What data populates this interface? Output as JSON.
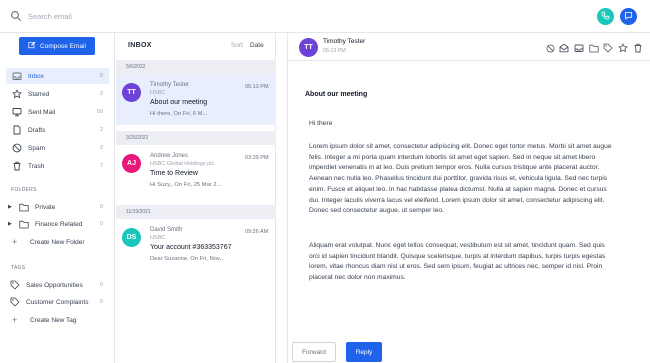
{
  "search": {
    "placeholder": "Search email"
  },
  "colors": {
    "accent": "#1e63e9",
    "phone": "#19c6b9"
  },
  "sidebar": {
    "compose_label": "Compose Email",
    "nav": [
      {
        "label": "Inbox",
        "count": "0",
        "icon": "inbox-icon"
      },
      {
        "label": "Starred",
        "count": "2",
        "icon": "star-icon"
      },
      {
        "label": "Sent Mail",
        "count": "50",
        "icon": "monitor-icon"
      },
      {
        "label": "Drafts",
        "count": "2",
        "icon": "document-icon"
      },
      {
        "label": "Spam",
        "count": "2",
        "icon": "ban-icon"
      },
      {
        "label": "Trash",
        "count": "7",
        "icon": "trash-icon"
      }
    ],
    "folders_label": "FOLDERS",
    "folders": [
      {
        "label": "Private",
        "count": "0"
      },
      {
        "label": "Finance Related",
        "count": "0"
      }
    ],
    "create_folder": "Create New Folder",
    "tags_label": "TAGS",
    "tags": [
      {
        "label": "Sales Opportunities",
        "count": "0"
      },
      {
        "label": "Customer Complaints",
        "count": "0"
      }
    ],
    "create_tag": "Create New Tag"
  },
  "inbox": {
    "title": "INBOX",
    "sort_label": "Sort",
    "sort_value": "Date",
    "groups": [
      {
        "date": "5/6/2022"
      },
      {
        "date": "3/25/2022"
      },
      {
        "date": "11/19/2021"
      }
    ],
    "mails": [
      {
        "initials": "TT",
        "color": "#6d42d6",
        "from": "Timothy Tester",
        "org": "HSBC",
        "subject": "About our meeting",
        "snippet": "Hi there, On Fri, 6 M...",
        "time": "05:13 PM"
      },
      {
        "initials": "AJ",
        "color": "#e8177a",
        "from": "Andrew Jones",
        "org": "HSBC Global Holdings plc",
        "subject": "Time to Review",
        "snippet": "Hi Suzy,, On Fri, 25 Mar 2...",
        "time": "03:39 PM"
      },
      {
        "initials": "DS",
        "color": "#19c6b9",
        "from": "David Smith",
        "org": "HSBC",
        "subject": "Your account #363353767",
        "snippet": "Dear Suzanne, On Fri, Nov...",
        "time": "09:26 AM"
      }
    ]
  },
  "reader": {
    "initials": "TT",
    "from": "Timothy Tester",
    "time": "05:13 PM",
    "subject": "About our meeting",
    "greeting": "Hi there",
    "para1": "Lorem ipsum dolor sit amet, consectetur adipiscing elit. Donec eget tortor metus. Morbi sit amet augue felis. Integer a mi porta quam interdum lobortis sit amet eget sapien. Sed in neque sit amet libero imperdiet venenatis in at leo. Duis pretium tempor eros. Nulla cursus tristique ante placerat auctor. Aenean nec nulla leo. Phasellus tincidunt dui porttitor, gravida risus et, vehicula ligula. Sed nec turpis enim. Fusce et aliquet leo. In hac habitasse platea dictumst. Nulla at sapien magna. Donec et cursus dui. Integer iaculis viverra lacus vel eleifend. Lorem ipsum dolor sit amet, consectetur adipiscing elit. Donec sed consectetur augue, ut semper leo.",
    "para2": "Aliquam erat volutpat. Nunc eget tellus consequat, vestibulum est sit amet, tincidunt quam. Sed quis orci id sapien tincidunt blandit. Quisque scelerisque, turpis at interdum dapibus, turpis turpis egestas lorem, vitae rhoncus diam nisl ut eros. Sed sem ipsum, feugiat ac ultrices nec, semper id nisl. Proin placerat nec dolor non maximus.",
    "forward_label": "Forward",
    "reply_label": "Reply"
  }
}
